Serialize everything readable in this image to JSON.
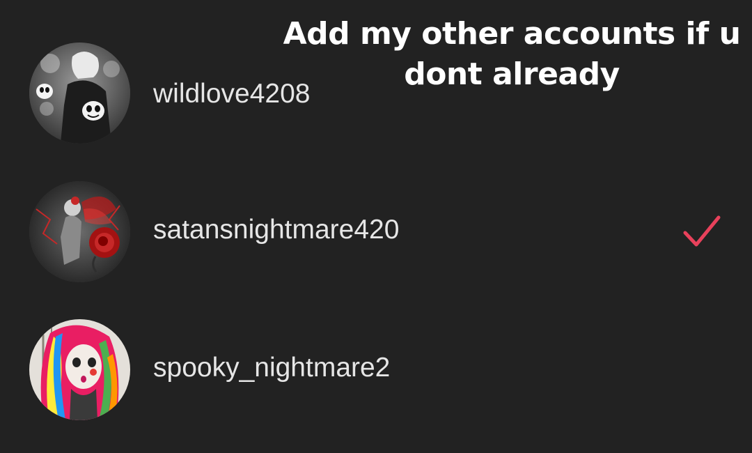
{
  "caption": "Add my other accounts if u dont already",
  "accounts": [
    {
      "username": "wildlove4208",
      "selected": false,
      "avatar_icon": "skeleton-girl-avatar"
    },
    {
      "username": "satansnightmare420",
      "selected": true,
      "avatar_icon": "fairy-rose-avatar"
    },
    {
      "username": "spooky_nightmare2",
      "selected": false,
      "avatar_icon": "rainbow-hair-girl-avatar"
    }
  ],
  "colors": {
    "background": "#222222",
    "check": "#e8415b",
    "text": "#e6e6e6"
  }
}
